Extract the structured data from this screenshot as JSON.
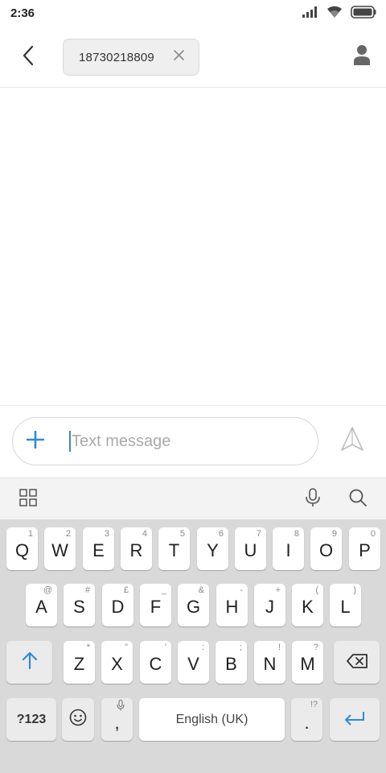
{
  "status_bar": {
    "time": "2:36"
  },
  "header": {
    "back_icon": "chevron-left-icon",
    "recipient": "18730218809",
    "remove_icon": "close-icon",
    "contact_icon": "person-icon"
  },
  "compose": {
    "attach_icon": "plus-icon",
    "placeholder": "Text message",
    "send_icon": "send-icon"
  },
  "keyboard_toolbar": {
    "left_icon": "grid-icon",
    "mic_icon": "microphone-icon",
    "search_icon": "search-icon"
  },
  "keyboard": {
    "row1": [
      {
        "label": "Q",
        "hint": "1"
      },
      {
        "label": "W",
        "hint": "2"
      },
      {
        "label": "E",
        "hint": "3"
      },
      {
        "label": "R",
        "hint": "4"
      },
      {
        "label": "T",
        "hint": "5"
      },
      {
        "label": "Y",
        "hint": "6"
      },
      {
        "label": "U",
        "hint": "7"
      },
      {
        "label": "I",
        "hint": "8"
      },
      {
        "label": "O",
        "hint": "9"
      },
      {
        "label": "P",
        "hint": "0"
      }
    ],
    "row2": [
      {
        "label": "A",
        "hint": "@"
      },
      {
        "label": "S",
        "hint": "#"
      },
      {
        "label": "D",
        "hint": "£"
      },
      {
        "label": "F",
        "hint": "_"
      },
      {
        "label": "G",
        "hint": "&"
      },
      {
        "label": "H",
        "hint": "-"
      },
      {
        "label": "J",
        "hint": "+"
      },
      {
        "label": "K",
        "hint": "("
      },
      {
        "label": "L",
        "hint": ")"
      }
    ],
    "row3": [
      {
        "label": "Z",
        "hint": "*"
      },
      {
        "label": "X",
        "hint": "\""
      },
      {
        "label": "C",
        "hint": "'"
      },
      {
        "label": "V",
        "hint": ":"
      },
      {
        "label": "B",
        "hint": ";"
      },
      {
        "label": "N",
        "hint": "!"
      },
      {
        "label": "M",
        "hint": "?"
      }
    ],
    "symbols_label": "?123",
    "comma_label": ",",
    "space_label": "English (UK)",
    "period_label": ".",
    "period_hint": "!?",
    "shift_icon": "shift-icon",
    "backspace_icon": "backspace-icon",
    "emoji_icon": "emoji-icon",
    "comma_mic_icon": "microphone-icon",
    "enter_icon": "enter-icon"
  },
  "colors": {
    "accent": "#2e8ad8",
    "keyboard_bg": "#d9d9d9",
    "key_bg": "#ffffff"
  }
}
